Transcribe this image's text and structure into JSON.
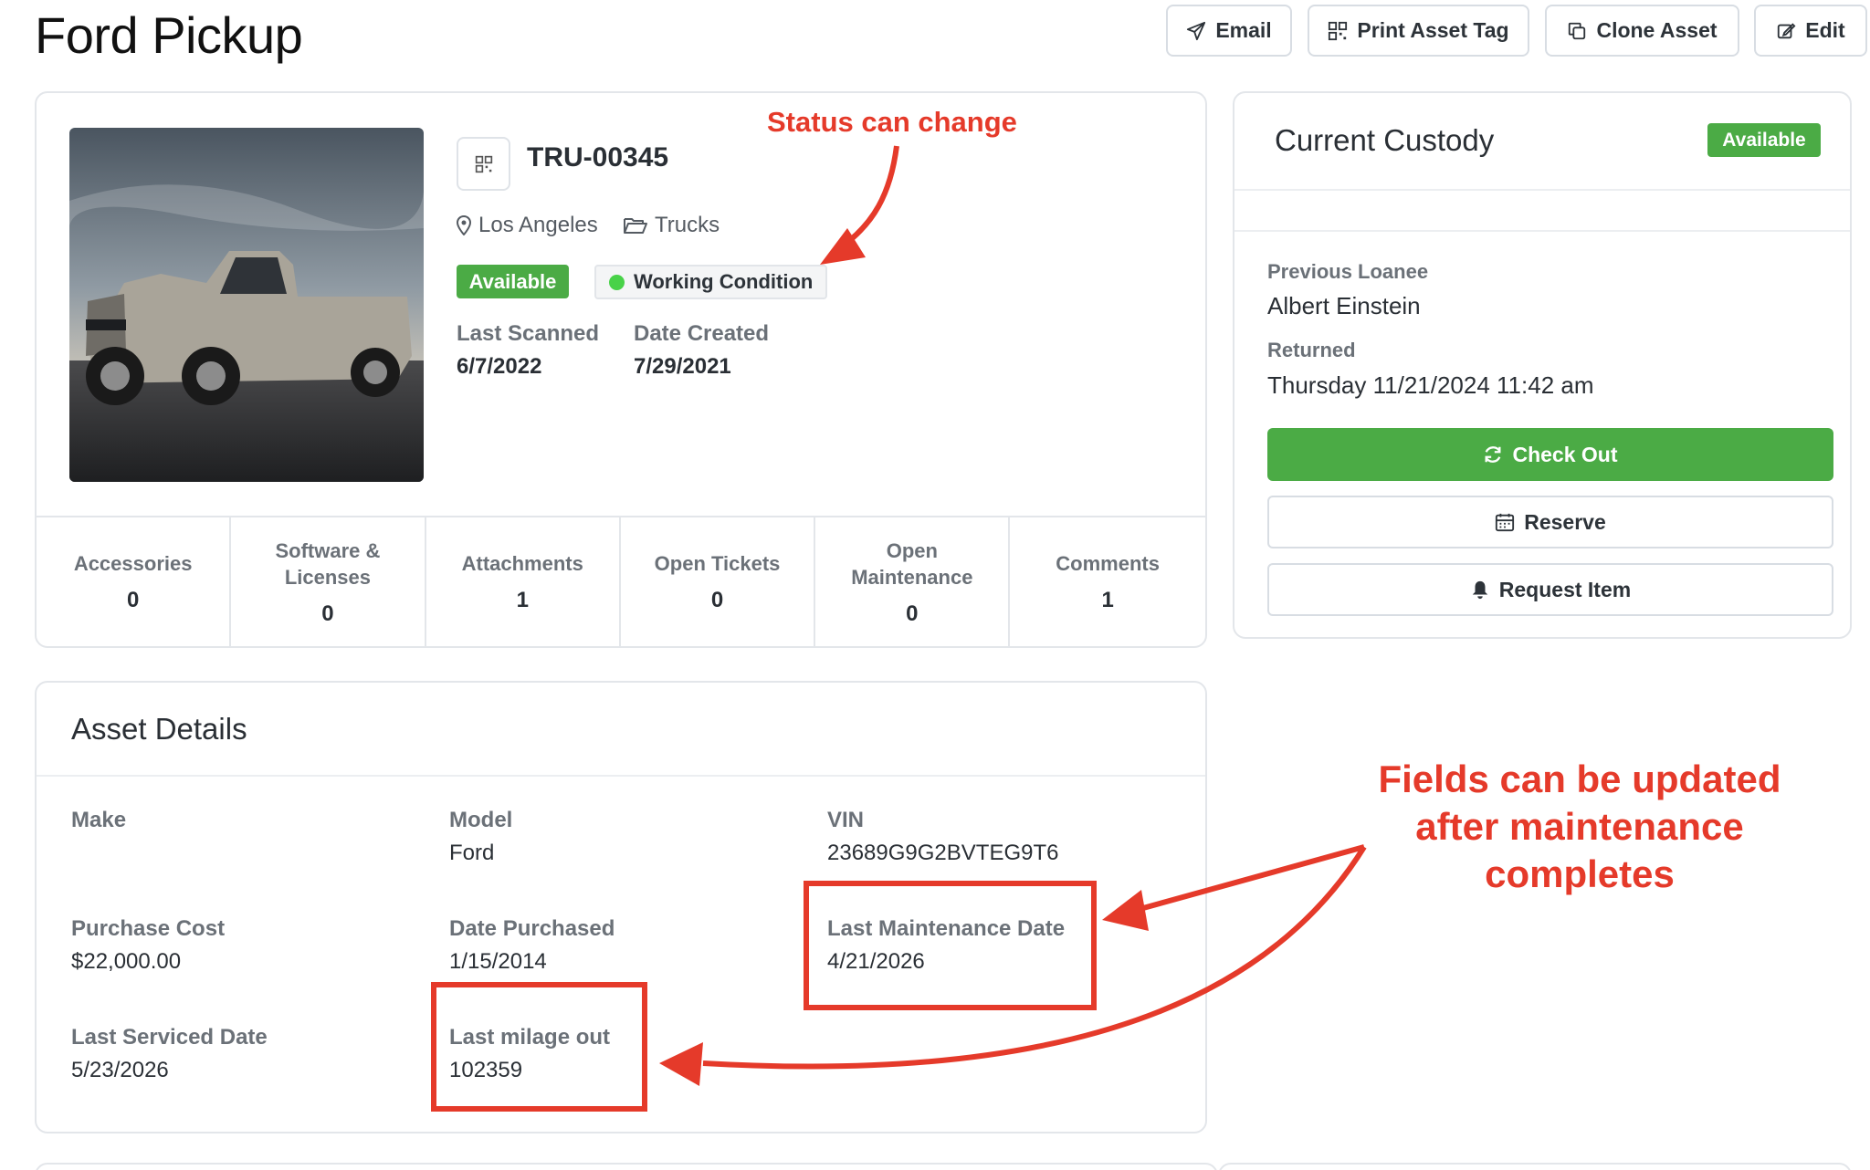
{
  "page": {
    "title": "Ford Pickup"
  },
  "toolbar": {
    "email_label": "Email",
    "print_label": "Print Asset Tag",
    "clone_label": "Clone Asset",
    "edit_label": "Edit"
  },
  "asset": {
    "tag": "TRU-00345",
    "location": "Los Angeles",
    "category": "Trucks",
    "status_badge": "Available",
    "condition": "Working Condition",
    "last_scanned_label": "Last Scanned",
    "last_scanned": "6/7/2022",
    "date_created_label": "Date Created",
    "date_created": "7/29/2021"
  },
  "stats": [
    {
      "label": "Accessories",
      "value": "0"
    },
    {
      "label": "Software & Licenses",
      "value": "0"
    },
    {
      "label": "Attachments",
      "value": "1"
    },
    {
      "label": "Open Tickets",
      "value": "0"
    },
    {
      "label": "Open Maintenance",
      "value": "0"
    },
    {
      "label": "Comments",
      "value": "1"
    }
  ],
  "custody": {
    "title": "Current Custody",
    "badge": "Available",
    "previous_loanee_label": "Previous Loanee",
    "previous_loanee": "Albert Einstein",
    "returned_label": "Returned",
    "returned": "Thursday 11/21/2024 11:42 am",
    "checkout_label": "Check Out",
    "reserve_label": "Reserve",
    "request_label": "Request Item"
  },
  "details": {
    "title": "Asset Details",
    "make_label": "Make",
    "make": "",
    "model_label": "Model",
    "model": "Ford",
    "vin_label": "VIN",
    "vin": "23689G9G2BVTEG9T6",
    "purchase_cost_label": "Purchase Cost",
    "purchase_cost": "$22,000.00",
    "date_purchased_label": "Date Purchased",
    "date_purchased": "1/15/2014",
    "last_maintenance_label": "Last Maintenance Date",
    "last_maintenance": "4/21/2026",
    "last_serviced_label": "Last Serviced Date",
    "last_serviced": "5/23/2026",
    "last_milage_label": "Last milage out",
    "last_milage": "102359"
  },
  "annotations": {
    "status": "Status can change",
    "fields_line1": "Fields can be updated",
    "fields_line2": "after maintenance",
    "fields_line3": "completes"
  },
  "colors": {
    "accent_green": "#4bab45",
    "annotation_red": "#e53a2a",
    "condition_dot": "#48d248"
  }
}
